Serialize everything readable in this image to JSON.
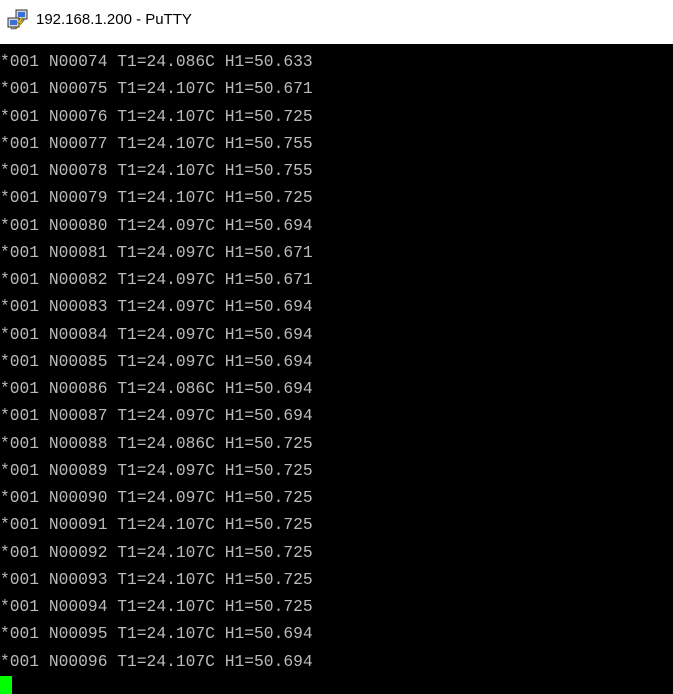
{
  "window": {
    "title": "192.168.1.200 - PuTTY",
    "icon": "putty-icon"
  },
  "terminal": {
    "background_color": "#000000",
    "text_color": "#bbbbbb",
    "cursor_color": "#00ff00",
    "lines": [
      "*001 N00074 T1=24.086C H1=50.633",
      "*001 N00075 T1=24.107C H1=50.671",
      "*001 N00076 T1=24.107C H1=50.725",
      "*001 N00077 T1=24.107C H1=50.755",
      "*001 N00078 T1=24.107C H1=50.755",
      "*001 N00079 T1=24.107C H1=50.725",
      "*001 N00080 T1=24.097C H1=50.694",
      "*001 N00081 T1=24.097C H1=50.671",
      "*001 N00082 T1=24.097C H1=50.671",
      "*001 N00083 T1=24.097C H1=50.694",
      "*001 N00084 T1=24.097C H1=50.694",
      "*001 N00085 T1=24.097C H1=50.694",
      "*001 N00086 T1=24.086C H1=50.694",
      "*001 N00087 T1=24.097C H1=50.694",
      "*001 N00088 T1=24.086C H1=50.725",
      "*001 N00089 T1=24.097C H1=50.725",
      "*001 N00090 T1=24.097C H1=50.725",
      "*001 N00091 T1=24.107C H1=50.725",
      "*001 N00092 T1=24.107C H1=50.725",
      "*001 N00093 T1=24.107C H1=50.725",
      "*001 N00094 T1=24.107C H1=50.725",
      "*001 N00095 T1=24.107C H1=50.694",
      "*001 N00096 T1=24.107C H1=50.694"
    ]
  }
}
